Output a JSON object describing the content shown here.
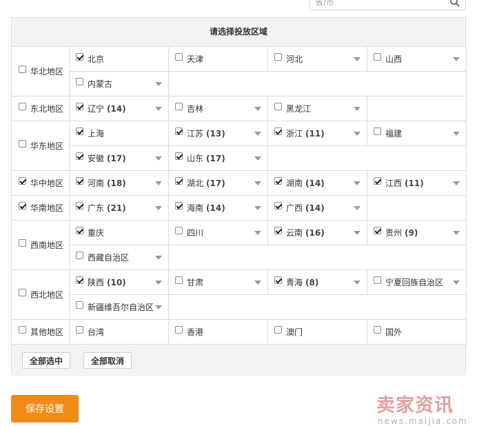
{
  "search": {
    "placeholder": "省/市"
  },
  "panel": {
    "title": "请选择投放区域"
  },
  "regions": [
    {
      "name": "华北地区",
      "checked": false,
      "rows": [
        [
          {
            "name": "北京",
            "checked": true,
            "count": "",
            "dropdown": false
          },
          {
            "name": "天津",
            "checked": false,
            "count": "",
            "dropdown": false
          },
          {
            "name": "河北",
            "checked": false,
            "count": "",
            "dropdown": true
          },
          {
            "name": "山西",
            "checked": false,
            "count": "",
            "dropdown": true
          }
        ],
        [
          {
            "name": "内蒙古",
            "checked": false,
            "count": "",
            "dropdown": true
          }
        ]
      ]
    },
    {
      "name": "东北地区",
      "checked": false,
      "rows": [
        [
          {
            "name": "辽宁",
            "checked": true,
            "count": "(14)",
            "dropdown": true
          },
          {
            "name": "吉林",
            "checked": false,
            "count": "",
            "dropdown": true
          },
          {
            "name": "黑龙江",
            "checked": false,
            "count": "",
            "dropdown": true
          }
        ]
      ]
    },
    {
      "name": "华东地区",
      "checked": false,
      "rows": [
        [
          {
            "name": "上海",
            "checked": true,
            "count": "",
            "dropdown": false
          },
          {
            "name": "江苏",
            "checked": true,
            "count": "(13)",
            "dropdown": true
          },
          {
            "name": "浙江",
            "checked": true,
            "count": "(11)",
            "dropdown": true
          },
          {
            "name": "福建",
            "checked": false,
            "count": "",
            "dropdown": true
          }
        ],
        [
          {
            "name": "安徽",
            "checked": true,
            "count": "(17)",
            "dropdown": true
          },
          {
            "name": "山东",
            "checked": true,
            "count": "(17)",
            "dropdown": true
          }
        ]
      ]
    },
    {
      "name": "华中地区",
      "checked": true,
      "rows": [
        [
          {
            "name": "河南",
            "checked": true,
            "count": "(18)",
            "dropdown": true
          },
          {
            "name": "湖北",
            "checked": true,
            "count": "(17)",
            "dropdown": true
          },
          {
            "name": "湖南",
            "checked": true,
            "count": "(14)",
            "dropdown": true
          },
          {
            "name": "江西",
            "checked": true,
            "count": "(11)",
            "dropdown": true
          }
        ]
      ]
    },
    {
      "name": "华南地区",
      "checked": true,
      "rows": [
        [
          {
            "name": "广东",
            "checked": true,
            "count": "(21)",
            "dropdown": true
          },
          {
            "name": "海南",
            "checked": true,
            "count": "(14)",
            "dropdown": true
          },
          {
            "name": "广西",
            "checked": true,
            "count": "(14)",
            "dropdown": true
          }
        ]
      ]
    },
    {
      "name": "西南地区",
      "checked": false,
      "rows": [
        [
          {
            "name": "重庆",
            "checked": true,
            "count": "",
            "dropdown": false
          },
          {
            "name": "四川",
            "checked": false,
            "count": "",
            "dropdown": true
          },
          {
            "name": "云南",
            "checked": true,
            "count": "(16)",
            "dropdown": true
          },
          {
            "name": "贵州",
            "checked": true,
            "count": "(9)",
            "dropdown": true
          }
        ],
        [
          {
            "name": "西藏自治区",
            "checked": false,
            "count": "",
            "dropdown": true
          }
        ]
      ]
    },
    {
      "name": "西北地区",
      "checked": false,
      "rows": [
        [
          {
            "name": "陕西",
            "checked": true,
            "count": "(10)",
            "dropdown": true
          },
          {
            "name": "甘肃",
            "checked": false,
            "count": "",
            "dropdown": true
          },
          {
            "name": "青海",
            "checked": true,
            "count": "(8)",
            "dropdown": true
          },
          {
            "name": "宁夏回族自治区",
            "checked": false,
            "count": "",
            "dropdown": true
          }
        ],
        [
          {
            "name": "新疆维吾尔自治区",
            "checked": false,
            "count": "",
            "dropdown": true
          }
        ]
      ]
    },
    {
      "name": "其他地区",
      "checked": false,
      "rows": [
        [
          {
            "name": "台湾",
            "checked": false,
            "count": "",
            "dropdown": false
          },
          {
            "name": "香港",
            "checked": false,
            "count": "",
            "dropdown": false
          },
          {
            "name": "澳门",
            "checked": false,
            "count": "",
            "dropdown": false
          },
          {
            "name": "国外",
            "checked": false,
            "count": "",
            "dropdown": false
          }
        ]
      ]
    }
  ],
  "footer": {
    "select_all": "全部选中",
    "cancel_all": "全部取消"
  },
  "save_label": "保存设置",
  "watermark": {
    "main": "卖家资讯",
    "sub": "news.maijia.com"
  },
  "colors": {
    "accent": "#f28a17",
    "border": "#dcdcdc",
    "panel_bg": "#f3f3f3"
  }
}
